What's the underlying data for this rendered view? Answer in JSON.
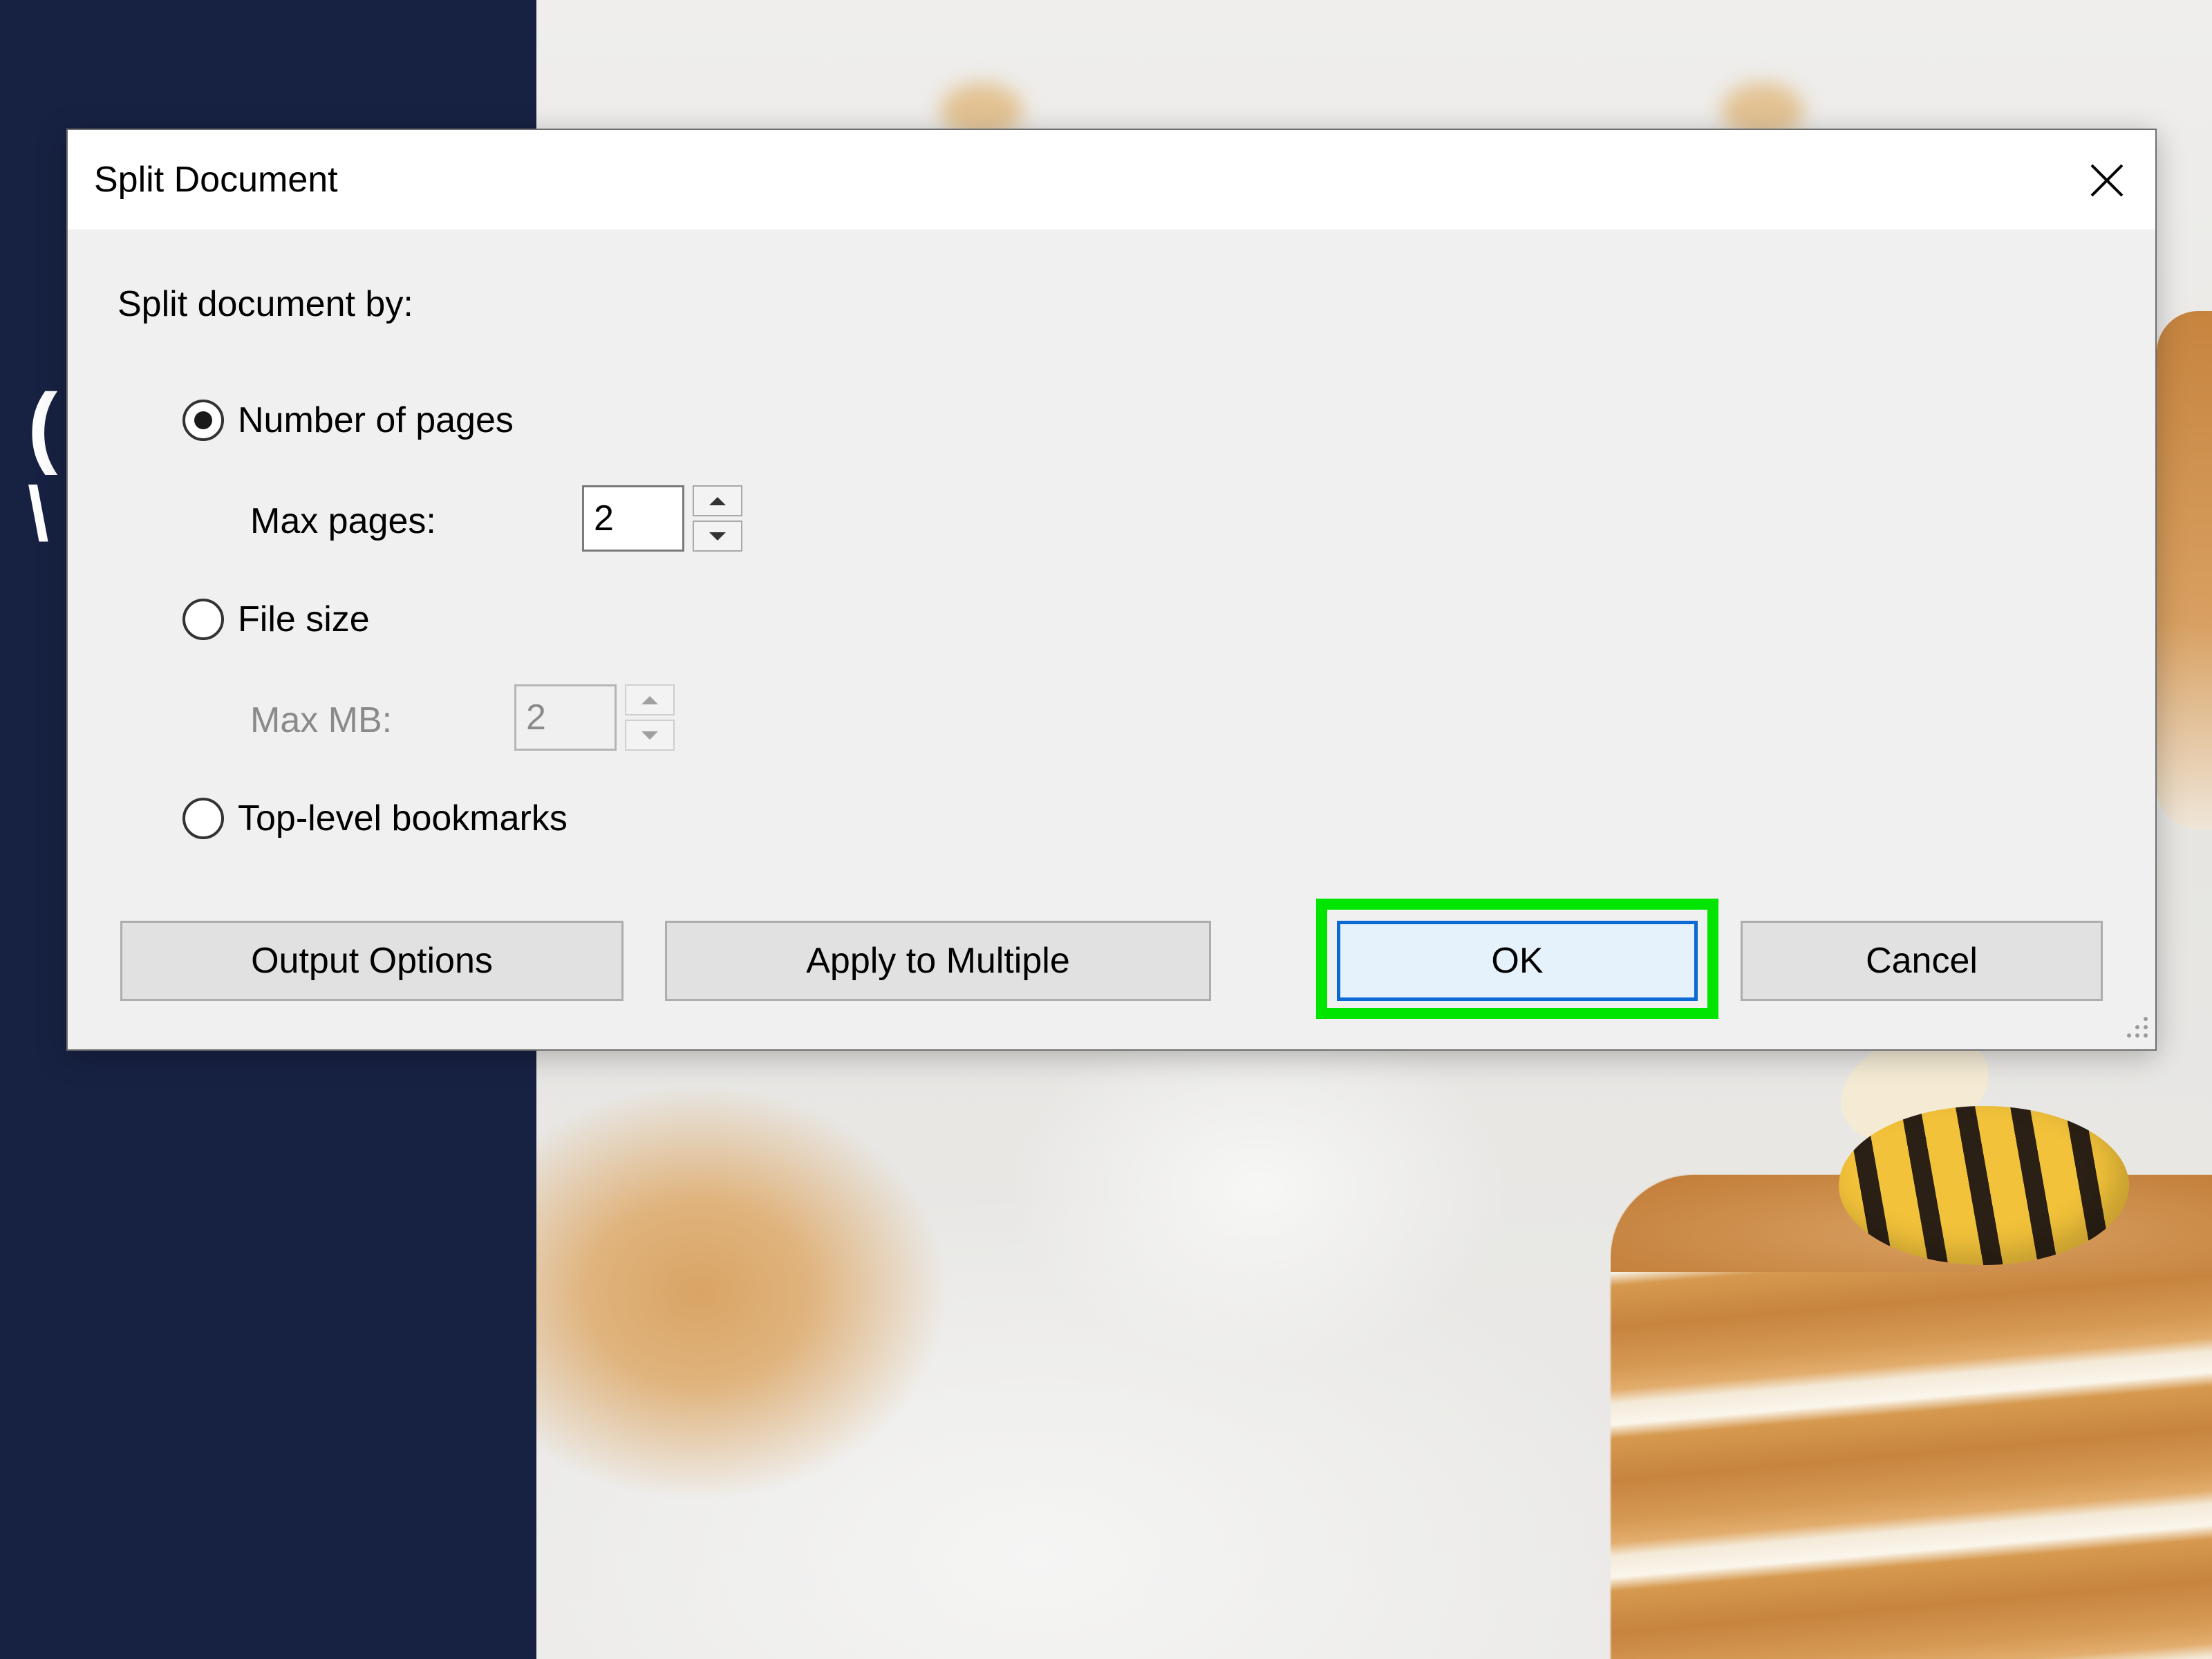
{
  "dialog": {
    "title": "Split Document",
    "section_label": "Split document by:",
    "options": {
      "number_of_pages": {
        "label": "Number of pages",
        "selected": true,
        "field_label": "Max pages:",
        "field_value": "2",
        "enabled": true
      },
      "file_size": {
        "label": "File size",
        "selected": false,
        "field_label": "Max MB:",
        "field_value": "2",
        "enabled": false
      },
      "top_level_bookmarks": {
        "label": "Top-level bookmarks",
        "selected": false
      }
    },
    "buttons": {
      "output_options": "Output Options",
      "apply_to_multiple": "Apply to Multiple",
      "ok": "OK",
      "cancel": "Cancel"
    }
  },
  "colors": {
    "highlight": "#00e500",
    "focus_border": "#0b6ad3",
    "left_panel": "#172142"
  },
  "icons": {
    "close": "close-icon",
    "spin_up": "spin-up-icon",
    "spin_down": "spin-down-icon",
    "grip": "resize-grip-icon"
  }
}
